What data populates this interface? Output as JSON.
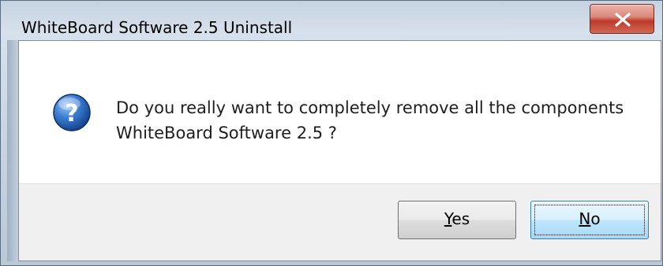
{
  "window": {
    "title": "WhiteBoard Software 2.5 Uninstall",
    "close_icon": "close-x-icon"
  },
  "message": {
    "icon": "question-icon",
    "line1": "Do you really want to completely remove all the components",
    "line2": "WhiteBoard Software 2.5 ?"
  },
  "buttons": {
    "yes": {
      "mnemonic": "Y",
      "rest": "es"
    },
    "no": {
      "mnemonic": "N",
      "rest": "o"
    }
  },
  "colors": {
    "close_button": "#c0392b",
    "focused_button_border": "#3c7fb1"
  }
}
